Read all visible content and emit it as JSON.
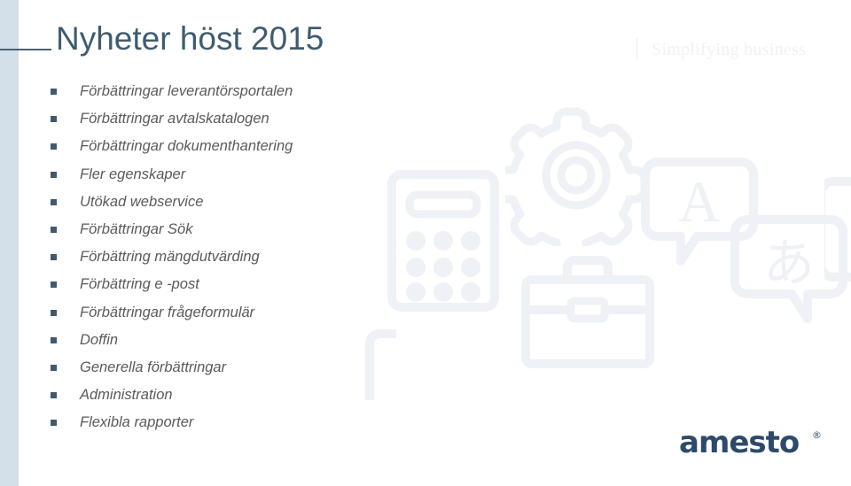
{
  "slide": {
    "title": "Nyheter höst 2015",
    "tagline": "Simplifying business",
    "logo_text": "amesto",
    "logo_trademark": "®"
  },
  "colors": {
    "background": "#ffffff",
    "left_bar": "#d3e0e9",
    "title_text": "#3e5c70",
    "title_rule": "#4a6274",
    "bullet_marker": "#42596b",
    "bullet_text": "#5a5a5a",
    "tagline_text": "#eef2f6",
    "logo": "#2d4a6b",
    "watermark": "#eef1f5"
  },
  "bullets": [
    {
      "label": "Förbättringar leverantörsportalen"
    },
    {
      "label": "Förbättringar avtalskatalogen"
    },
    {
      "label": "Förbättringar dokumenthantering"
    },
    {
      "label": "Fler egenskaper"
    },
    {
      "label": "Utökad webservice"
    },
    {
      "label": "Förbättringar Sök"
    },
    {
      "label": "Förbättring mängdutvärding"
    },
    {
      "label": "Förbättring e -post"
    },
    {
      "label": "Förbättringar frågeformulär"
    },
    {
      "label": "Doffin"
    },
    {
      "label": "Generella förbättringar"
    },
    {
      "label": "Administration"
    },
    {
      "label": "Flexibla rapporter"
    }
  ],
  "watermarks": [
    {
      "name": "calculator-icon"
    },
    {
      "name": "gear-icon"
    },
    {
      "name": "briefcase-icon"
    },
    {
      "name": "speech-bubble-latin-a-icon"
    },
    {
      "name": "speech-bubble-japanese-a-icon"
    }
  ]
}
